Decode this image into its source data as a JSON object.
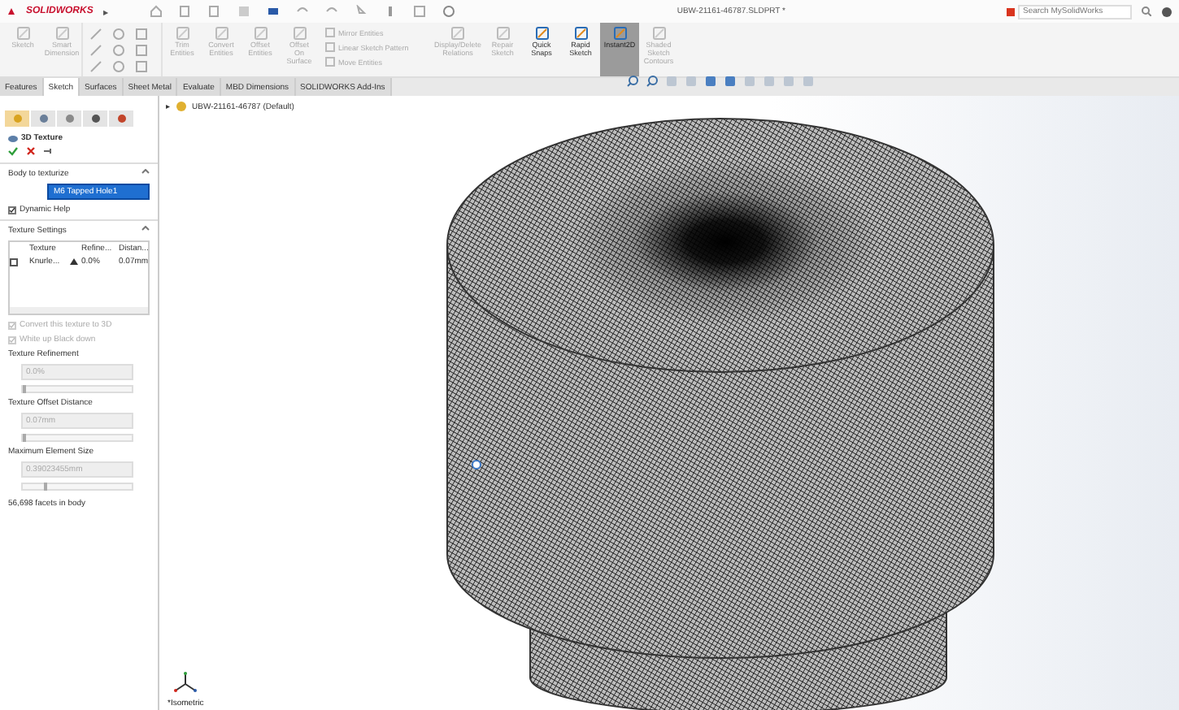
{
  "app": {
    "logo": "SOLIDWORKS",
    "menu_arrow": "▶"
  },
  "window": {
    "title": "UBW-21161-46787.SLDPRT *"
  },
  "search": {
    "placeholder": "Search MySolidWorks"
  },
  "ribbon": [
    {
      "kind": "large",
      "label": "Sketch",
      "disabled": true,
      "selected": false
    },
    {
      "kind": "large",
      "label": "Smart Dimension",
      "disabled": true,
      "selected": false
    },
    {
      "kind": "grid"
    },
    {
      "kind": "large",
      "label": "Trim Entities",
      "disabled": true,
      "selected": false
    },
    {
      "kind": "large",
      "label": "Convert Entities",
      "disabled": true,
      "selected": false
    },
    {
      "kind": "large",
      "label": "Offset Entities",
      "disabled": true,
      "selected": false
    },
    {
      "kind": "large",
      "label": "Offset On Surface",
      "disabled": true,
      "selected": false
    },
    {
      "kind": "stack",
      "items": [
        "Mirror Entities",
        "Linear Sketch Pattern",
        "Move Entities"
      ]
    },
    {
      "kind": "large",
      "label": "Display/Delete Relations",
      "disabled": true,
      "selected": false
    },
    {
      "kind": "large",
      "label": "Repair Sketch",
      "disabled": true,
      "selected": false
    },
    {
      "kind": "large",
      "label": "Quick Snaps",
      "disabled": false,
      "selected": false
    },
    {
      "kind": "large",
      "label": "Rapid Sketch",
      "disabled": false,
      "selected": false
    },
    {
      "kind": "large",
      "label": "Instant2D",
      "disabled": false,
      "selected": true
    },
    {
      "kind": "large",
      "label": "Shaded Sketch Contours",
      "disabled": true,
      "selected": false
    }
  ],
  "tabs": [
    {
      "label": "Features",
      "selected": false
    },
    {
      "label": "Sketch",
      "selected": true
    },
    {
      "label": "Surfaces",
      "selected": false
    },
    {
      "label": "Sheet Metal",
      "selected": false
    },
    {
      "label": "Evaluate",
      "selected": false
    },
    {
      "label": "MBD Dimensions",
      "selected": false
    },
    {
      "label": "SOLIDWORKS Add-Ins",
      "selected": false
    }
  ],
  "panel_tabs": [
    {
      "selected": true
    },
    {
      "selected": false
    },
    {
      "selected": false
    },
    {
      "selected": false
    },
    {
      "selected": false
    }
  ],
  "property_manager": {
    "title": "3D Texture",
    "body_section": {
      "title": "Body to texturize",
      "value": "M6 Tapped Hole1",
      "dynamic_help": {
        "label": "Dynamic Help",
        "checked": true
      }
    },
    "texture_section": {
      "title": "Texture Settings",
      "columns": [
        "Texture",
        "Refine...",
        "Distan..."
      ],
      "rows": [
        {
          "cells": [
            "Knurle...",
            "0.0%",
            "0.07mm"
          ]
        }
      ],
      "options": [
        {
          "label": "Convert this texture to 3D",
          "checked": true,
          "disabled": true
        },
        {
          "label": "White up Black down",
          "checked": true,
          "disabled": true
        }
      ],
      "settings": [
        {
          "label": "Texture Refinement",
          "value": "0.0%",
          "level": 0,
          "disabled": true
        },
        {
          "label": "Texture Offset Distance",
          "value": "0.07mm",
          "level": 0,
          "disabled": true
        },
        {
          "label": "Maximum Element Size",
          "value": "0.39023455mm",
          "level": 0.2,
          "disabled": true
        }
      ],
      "facets": "56,698 facets in body"
    }
  },
  "viewport": {
    "tree_item": "UBW-21161-46787 (Default)",
    "tree_arrow": "▸",
    "view_label": "*Isometric"
  }
}
